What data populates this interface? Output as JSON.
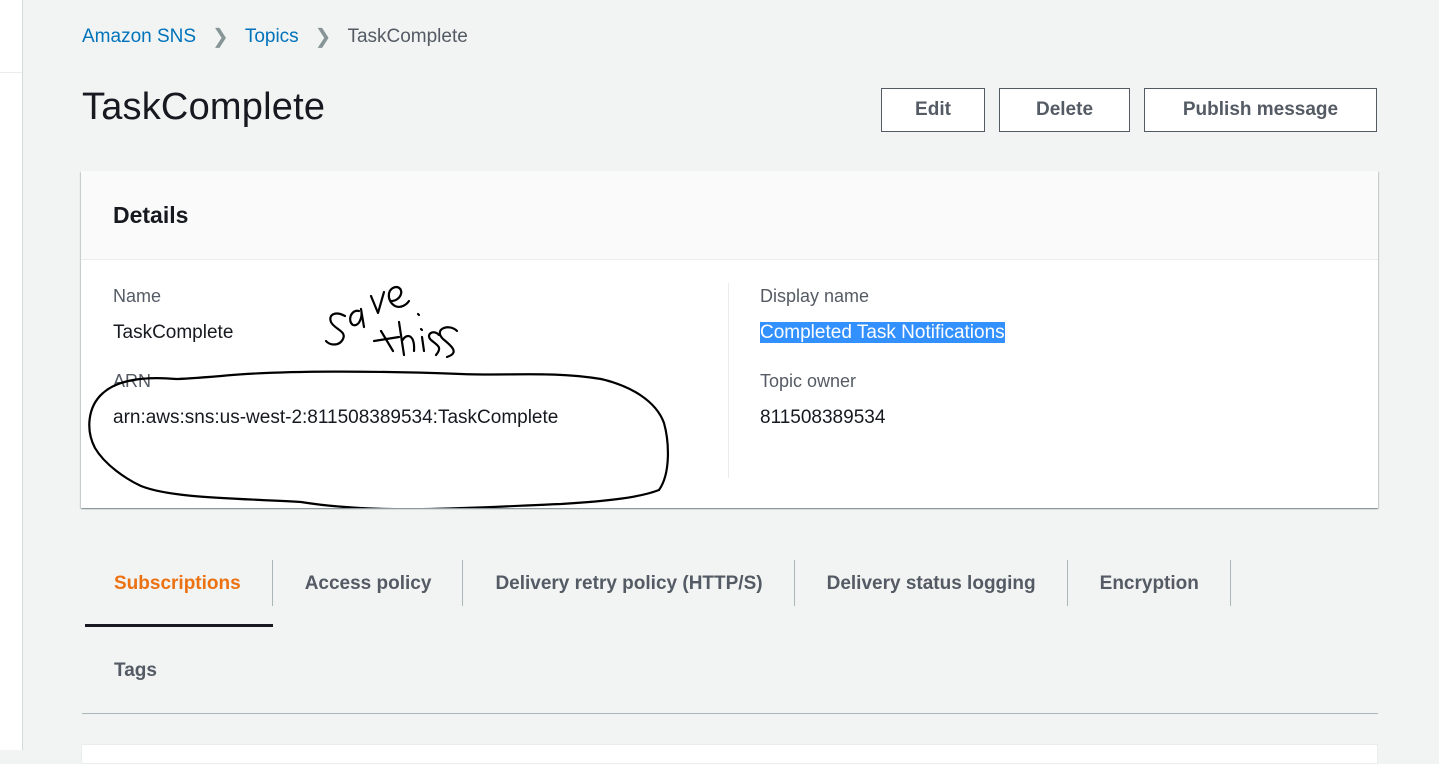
{
  "breadcrumb": {
    "items": [
      "Amazon SNS",
      "Topics"
    ],
    "current": "TaskComplete"
  },
  "page": {
    "title": "TaskComplete"
  },
  "actions": {
    "edit": "Edit",
    "delete": "Delete",
    "publish": "Publish message"
  },
  "details": {
    "heading": "Details",
    "name_label": "Name",
    "name_value": "TaskComplete",
    "arn_label": "ARN",
    "arn_value": "arn:aws:sns:us-west-2:811508389534:TaskComplete",
    "display_name_label": "Display name",
    "display_name_value": "Completed Task Notifications",
    "owner_label": "Topic owner",
    "owner_value": "811508389534",
    "annotation_text": "save this"
  },
  "tabs": [
    "Subscriptions",
    "Access policy",
    "Delivery retry policy (HTTP/S)",
    "Delivery status logging",
    "Encryption",
    "Tags"
  ],
  "active_tab": "Subscriptions",
  "colors": {
    "link": "#0073bb",
    "active_tab": "#ec7211",
    "selection": "#3390ff",
    "background": "#f2f3f3"
  }
}
